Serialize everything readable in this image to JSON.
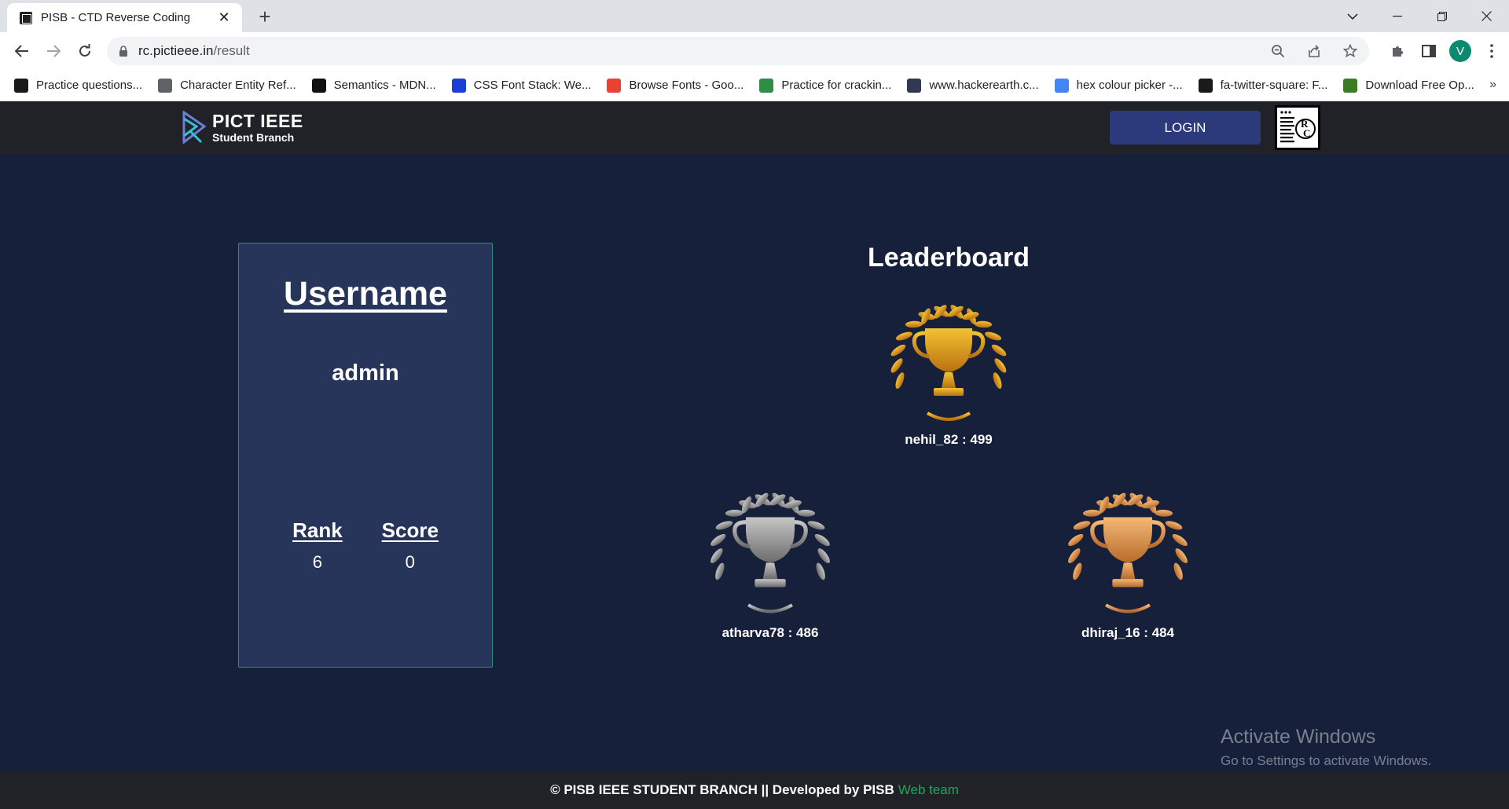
{
  "browser": {
    "tab_title": "PISB - CTD Reverse Coding",
    "url_host": "rc.pictieee.in",
    "url_path": "/result",
    "profile_initial": "V",
    "bookmarks": [
      {
        "label": "Practice questions...",
        "color": "#1a1a1a"
      },
      {
        "label": "Character Entity Ref...",
        "color": "#5f6368"
      },
      {
        "label": "Semantics - MDN...",
        "color": "#111111"
      },
      {
        "label": "CSS Font Stack: We...",
        "color": "#1a3fd8"
      },
      {
        "label": "Browse Fonts - Goo...",
        "color": "#ea4335"
      },
      {
        "label": "Practice for crackin...",
        "color": "#2f8d46"
      },
      {
        "label": "www.hackerearth.c...",
        "color": "#323754"
      },
      {
        "label": "hex colour picker -...",
        "color": "#4285f4"
      },
      {
        "label": "fa-twitter-square: F...",
        "color": "#1a1a1a"
      },
      {
        "label": "Download Free Op...",
        "color": "#3b7d23"
      }
    ],
    "more_bookmarks": "»"
  },
  "header": {
    "logo_title": "PICT IEEE",
    "logo_subtitle": "Student Branch",
    "login_label": "LOGIN"
  },
  "user_card": {
    "heading": "Username",
    "username": "admin",
    "rank_label": "Rank",
    "rank_value": "6",
    "score_label": "Score",
    "score_value": "0"
  },
  "leaderboard": {
    "title": "Leaderboard",
    "entries": [
      {
        "caption": "nehil_82 : 499",
        "medal": "gold",
        "color_light": "#f3c234",
        "color_dark": "#b9700f"
      },
      {
        "caption": "atharva78 : 486",
        "medal": "silver",
        "color_light": "#c6c6c6",
        "color_dark": "#6b6b6b"
      },
      {
        "caption": "dhiraj_16 : 484",
        "medal": "bronze",
        "color_light": "#f4b877",
        "color_dark": "#b86b2a"
      }
    ]
  },
  "watermark": {
    "title": "Activate Windows",
    "subtitle": "Go to Settings to activate Windows."
  },
  "footer": {
    "text": "© PISB IEEE STUDENT BRANCH || Developed by PISB",
    "link": "Web team"
  }
}
